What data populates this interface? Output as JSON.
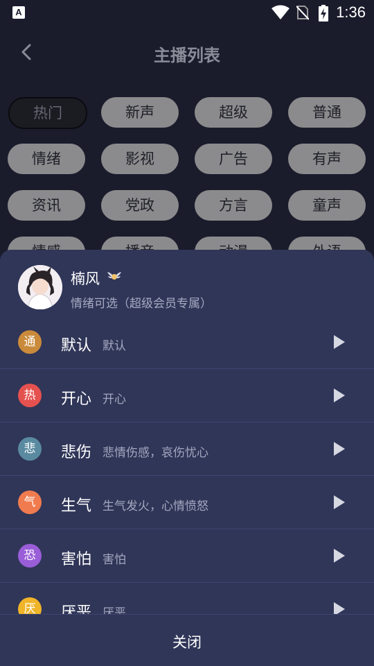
{
  "status_bar": {
    "time": "1:36",
    "app_icon_letter": "A"
  },
  "header": {
    "title": "主播列表",
    "back_icon": "chevron-left-icon"
  },
  "chips": [
    "热门",
    "新声",
    "超级",
    "普通",
    "情绪",
    "影视",
    "广告",
    "有声",
    "资讯",
    "党政",
    "方言",
    "童声",
    "情感",
    "播音",
    "动漫",
    "外语"
  ],
  "active_chip": "热门",
  "panel": {
    "profile": {
      "name": "楠风",
      "subtitle": "情绪可选（超级会员专属）",
      "badge_icon": "vip-wings-icon"
    },
    "emotions": [
      {
        "tag": "通",
        "name": "默认",
        "desc": "默认",
        "color": "#c98a3a"
      },
      {
        "tag": "热",
        "name": "开心",
        "desc": "开心",
        "color": "#e5514f"
      },
      {
        "tag": "悲",
        "name": "悲伤",
        "desc": "悲情伤感，哀伤忧心",
        "color": "#5a8aa0"
      },
      {
        "tag": "气",
        "name": "生气",
        "desc": "生气发火，心情愤怒",
        "color": "#f07b4e"
      },
      {
        "tag": "恐",
        "name": "害怕",
        "desc": "害怕",
        "color": "#9a5ed9"
      },
      {
        "tag": "厌",
        "name": "厌恶",
        "desc": "厌恶",
        "color": "#f0b429"
      }
    ],
    "close_label": "关闭"
  }
}
